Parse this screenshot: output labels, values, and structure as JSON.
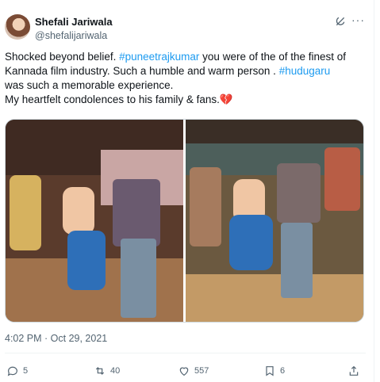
{
  "author": {
    "name": "Shefali Jariwala",
    "handle": "@shefalijariwala"
  },
  "tweet": {
    "line1_before": "Shocked beyond belief. ",
    "line1_tag": "#puneetrajkumar",
    "line1_after": " you were of the of the finest of",
    "line2": "Kannada film industry. Such a humble and warm person . ",
    "line2_tag": "#hudugaru",
    "line3": "was such a memorable experience.",
    "line4": "My heartfelt condolences to his family & fans.💔"
  },
  "timestamp": "4:02 PM · Oct 29, 2021",
  "actions": {
    "replies": "5",
    "reposts": "40",
    "likes": "557",
    "bookmarks": "6"
  },
  "icons": [
    "avatar",
    "grok-icon",
    "more-icon",
    "reply-icon",
    "repost-icon",
    "like-icon",
    "bookmark-icon",
    "share-icon"
  ],
  "colors": {
    "link": "#1d9bf0",
    "secondary_text": "#536471",
    "text": "#0f1419"
  }
}
